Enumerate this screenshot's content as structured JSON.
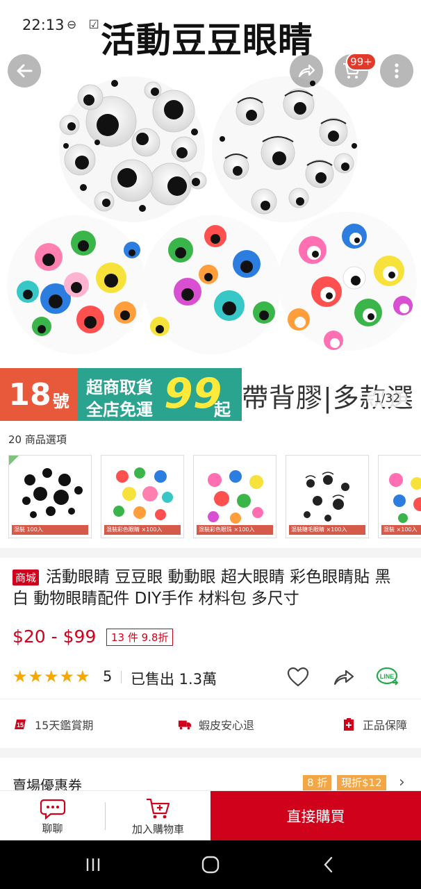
{
  "status_bar": {
    "time": "22:13",
    "icons": "⊖ ☑"
  },
  "hero": {
    "title": "活動豆豆眼睛",
    "cart_badge": "99+",
    "image_counter": "1/32",
    "banner": {
      "number": "18",
      "number_suffix": "號",
      "line1": "超商取貨",
      "line2": "全店免運",
      "price": "99",
      "price_suffix": "起",
      "tagline": "帶背膠|多款選"
    }
  },
  "options": {
    "label": "20 商品選項",
    "thumbs": [
      {
        "caption": "混裝 100入",
        "name": "black-white"
      },
      {
        "caption": "混裝彩色眼睛 ×100入",
        "name": "colorful"
      },
      {
        "caption": "混裝彩色眼珠 ×100入",
        "name": "colorful-2"
      },
      {
        "caption": "混裝睫毛眼睛 ×100入",
        "name": "lashes"
      },
      {
        "caption": "混裝 ×100入",
        "name": "mixed"
      }
    ]
  },
  "product": {
    "mall_tag": "商城",
    "title": "活動眼睛 豆豆眼 動動眼 超大眼睛 彩色眼睛貼 黑白 動物眼睛配件 DIY手作 材料包 多尺寸",
    "price": "$20 - $99",
    "discount": "13 件 9.8折",
    "stars": "★★★★★",
    "rating": "5",
    "sold": "已售出 1.3萬"
  },
  "guarantees": [
    {
      "label": "15天鑑賞期",
      "icon": "fifteen-day-icon"
    },
    {
      "label": "蝦皮安心退",
      "icon": "truck-return-icon"
    },
    {
      "label": "正品保障",
      "icon": "authentic-icon"
    }
  ],
  "vouchers": {
    "label": "賣場優惠券",
    "tags": [
      "8 折",
      "現折$12"
    ]
  },
  "bottom_bar": {
    "chat": "聊聊",
    "add_to_cart": "加入購物車",
    "buy_now": "直接購買"
  },
  "colors": {
    "brand_red": "#d0011b",
    "banner_orange": "#e8583a",
    "banner_teal": "#2aa38f",
    "banner_yellow": "#ffe93a",
    "star": "#f6a700",
    "voucher": "#f3a646"
  }
}
